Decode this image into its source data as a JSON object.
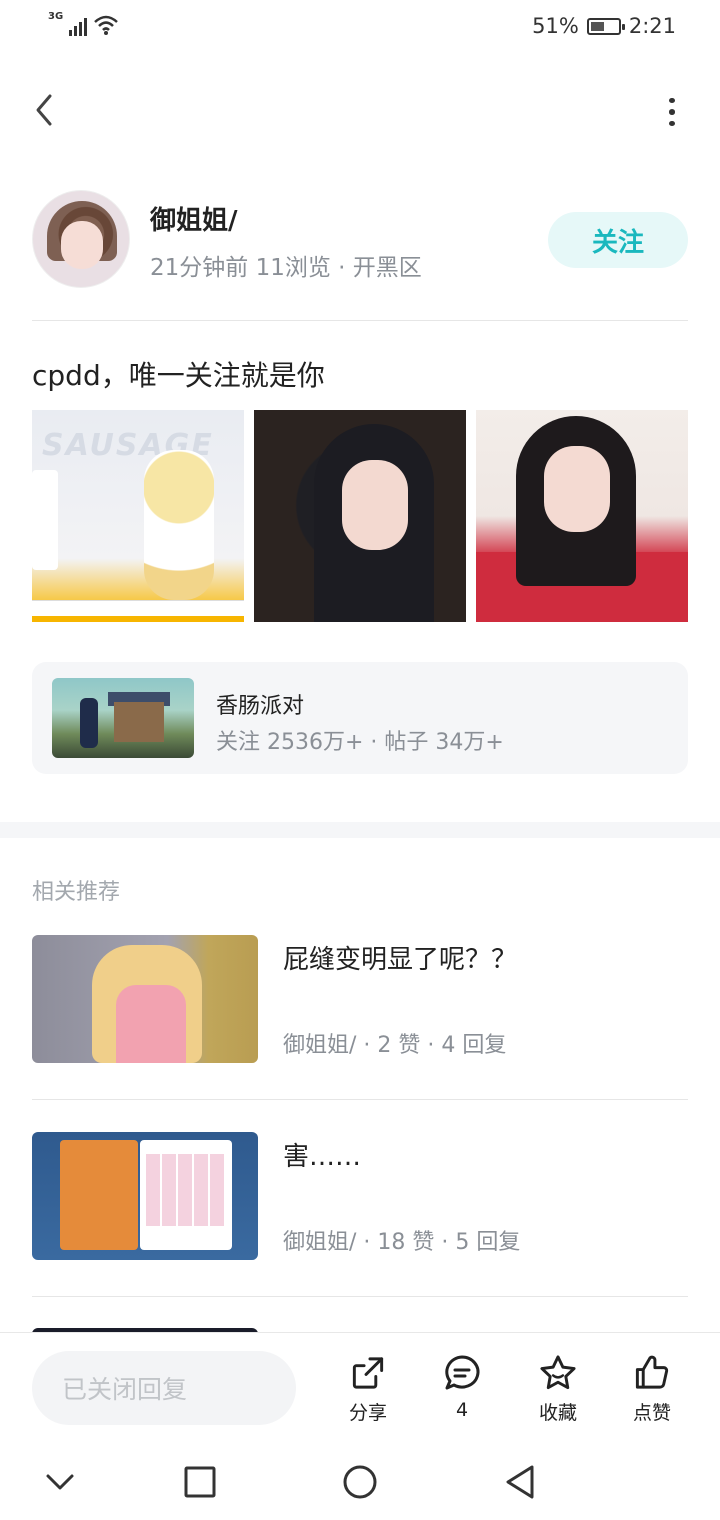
{
  "status_bar": {
    "network": "3G",
    "battery_percent": "51%",
    "battery_level": 0.51,
    "time": "2:21"
  },
  "header": {
    "back_icon": "chevron-left-icon",
    "more_icon": "more-vertical-icon"
  },
  "author": {
    "name": "御姐姐/",
    "meta": "21分钟前  11浏览 · 开黑区",
    "follow_label": "关注"
  },
  "post": {
    "text": "cpdd，唯一关注就是你",
    "image_watermark": "SAUSAGE"
  },
  "game_card": {
    "title": "香肠派对",
    "stats": "关注 2536万+ · 帖子 34万+"
  },
  "recommendations": {
    "heading": "相关推荐",
    "items": [
      {
        "title": "屁缝变明显了呢？？",
        "meta": "御姐姐/ · 2 赞 · 4 回复"
      },
      {
        "title": "害……",
        "meta": "御姐姐/ · 18 赞 · 5 回复"
      }
    ]
  },
  "bottom_bar": {
    "reply_placeholder": "已关闭回复",
    "share_label": "分享",
    "comment_count": "4",
    "favorite_label": "收藏",
    "like_label": "点赞"
  },
  "colors": {
    "accent": "#1ab8be",
    "follow_bg": "#e6f8f8",
    "meta_text": "#8a8f96",
    "card_bg": "#f5f6f8"
  }
}
